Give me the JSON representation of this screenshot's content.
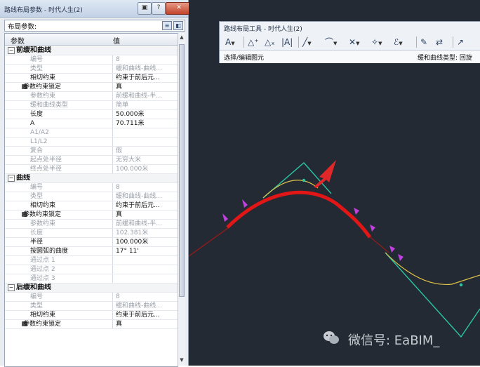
{
  "panel": {
    "title": "路线布局参数 - 时代人生(2)",
    "section_label": "布局参数:",
    "columns": [
      "参数",
      "值"
    ],
    "rows": [
      {
        "kind": "group",
        "name": "前缓和曲线",
        "val": ""
      },
      {
        "kind": "dim",
        "name": "编号",
        "val": "8"
      },
      {
        "kind": "dim",
        "name": "类型",
        "val": "缓和曲线-曲线..."
      },
      {
        "kind": "normal",
        "name": "相切约束",
        "val": "约束于前后元..."
      },
      {
        "kind": "lock",
        "name": "参数约束锁定",
        "val": "真"
      },
      {
        "kind": "dim",
        "name": "参数约束",
        "val": "前缓和曲线-半..."
      },
      {
        "kind": "dim",
        "name": "缓和曲线类型",
        "val": "简单"
      },
      {
        "kind": "normal",
        "name": "长度",
        "val": "50.000米"
      },
      {
        "kind": "normal",
        "name": "A",
        "val": "70.711米"
      },
      {
        "kind": "dim",
        "name": "A1/A2",
        "val": ""
      },
      {
        "kind": "dim",
        "name": "L1/L2",
        "val": ""
      },
      {
        "kind": "dim",
        "name": "复合",
        "val": "假"
      },
      {
        "kind": "dim",
        "name": "起点处半径",
        "val": "无穷大米"
      },
      {
        "kind": "dim",
        "name": "终点处半径",
        "val": "100.000米"
      },
      {
        "kind": "group",
        "name": "曲线",
        "val": ""
      },
      {
        "kind": "dim",
        "name": "编号",
        "val": "8"
      },
      {
        "kind": "dim",
        "name": "类型",
        "val": "缓和曲线-曲线..."
      },
      {
        "kind": "normal",
        "name": "相切约束",
        "val": "约束于前后元..."
      },
      {
        "kind": "lock",
        "name": "参数约束锁定",
        "val": "真"
      },
      {
        "kind": "dim",
        "name": "参数约束",
        "val": "前缓和曲线-半..."
      },
      {
        "kind": "dim",
        "name": "长度",
        "val": "102.381米"
      },
      {
        "kind": "normal",
        "name": "半径",
        "val": "100.000米"
      },
      {
        "kind": "normal",
        "name": "按圆弧的曲度",
        "val": "17° 11'"
      },
      {
        "kind": "dim",
        "name": "通过点 1",
        "val": ""
      },
      {
        "kind": "dim",
        "name": "通过点 2",
        "val": ""
      },
      {
        "kind": "dim",
        "name": "通过点 3",
        "val": ""
      },
      {
        "kind": "group",
        "name": "后缓和曲线",
        "val": ""
      },
      {
        "kind": "dim",
        "name": "编号",
        "val": "8"
      },
      {
        "kind": "dim",
        "name": "类型",
        "val": "缓和曲线-曲线..."
      },
      {
        "kind": "normal",
        "name": "相切约束",
        "val": "约束于前后元..."
      },
      {
        "kind": "lock",
        "name": "参数约束锁定",
        "val": "真"
      }
    ]
  },
  "toolbar": {
    "title": "路线布局工具 - 时代人生(2)",
    "status_left": "选择/编辑图元",
    "status_right": "缓和曲线类型: 回旋",
    "icons": [
      "point-A-icon",
      "add-PI-icon",
      "delete-PI-icon",
      "break-apart-icon",
      "tangent-line-icon",
      "curve-icon",
      "spiral-icon",
      "curve-spiral-icon",
      "free-curve-icon",
      "edit-icon",
      "reverse-icon"
    ]
  },
  "watermark": {
    "text": "微信号: EaBIM_"
  },
  "colors": {
    "canvas_bg": "#232a33",
    "selected_curve": "#e11616",
    "tangent_line": "#28c6a4",
    "spiral": "#e0c24a",
    "grip": "#c040e0",
    "arrow": "#e0282a"
  }
}
